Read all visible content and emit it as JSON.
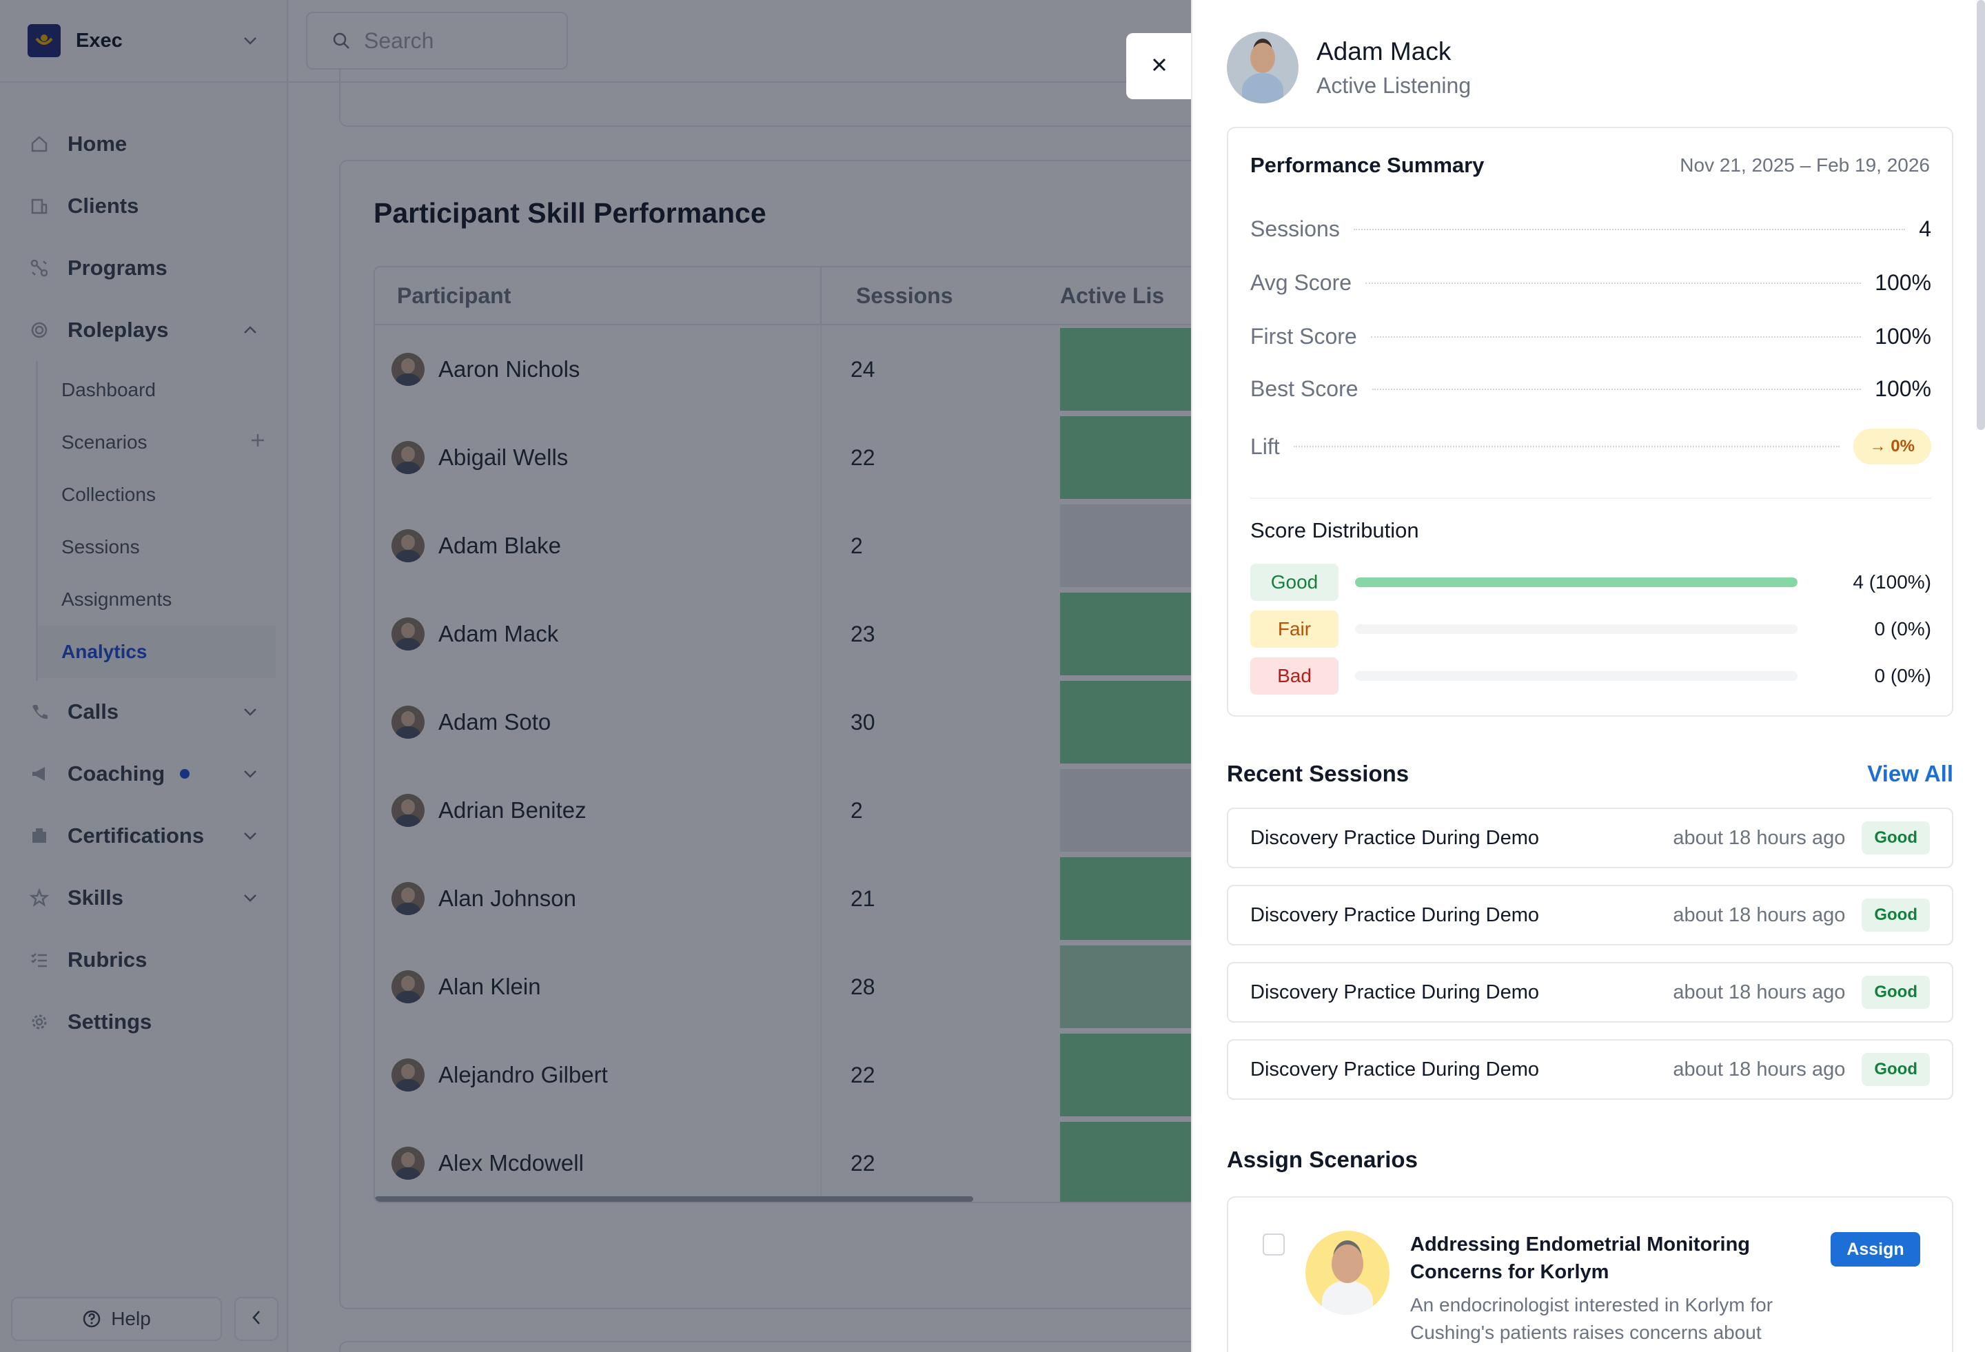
{
  "sidebar": {
    "org_name": "Exec",
    "nav": {
      "home": "Home",
      "clients": "Clients",
      "programs": "Programs",
      "roleplays": "Roleplays",
      "calls": "Calls",
      "coaching": "Coaching",
      "certifications": "Certifications",
      "skills": "Skills",
      "rubrics": "Rubrics",
      "settings": "Settings"
    },
    "roleplays_sub": {
      "dashboard": "Dashboard",
      "scenarios": "Scenarios",
      "collections": "Collections",
      "sessions": "Sessions",
      "assignments": "Assignments",
      "analytics": "Analytics"
    },
    "help_label": "Help"
  },
  "topbar": {
    "search_placeholder": "Search"
  },
  "main": {
    "card_title": "Participant Skill Performance",
    "columns": {
      "participant": "Participant",
      "sessions": "Sessions",
      "active_listening": "Active Lis"
    },
    "rows": [
      {
        "name": "Aaron Nichols",
        "sessions": "24",
        "heat": "#7fd39b"
      },
      {
        "name": "Abigail Wells",
        "sessions": "22",
        "heat": "#7fd39b"
      },
      {
        "name": "Adam Blake",
        "sessions": "2",
        "heat": "#e5e7eb"
      },
      {
        "name": "Adam Mack",
        "sessions": "23",
        "heat": "#7fd39b"
      },
      {
        "name": "Adam Soto",
        "sessions": "30",
        "heat": "#7fd39b"
      },
      {
        "name": "Adrian Benitez",
        "sessions": "2",
        "heat": "#e5e7eb"
      },
      {
        "name": "Alan Johnson",
        "sessions": "21",
        "heat": "#7fd39b"
      },
      {
        "name": "Alan Klein",
        "sessions": "28",
        "heat": "#a8d8b8"
      },
      {
        "name": "Alejandro Gilbert",
        "sessions": "22",
        "heat": "#7fd39b"
      },
      {
        "name": "Alex Mcdowell",
        "sessions": "22",
        "heat": "#7fd39b"
      }
    ]
  },
  "drawer": {
    "name": "Adam Mack",
    "skill": "Active Listening",
    "summary": {
      "title": "Performance Summary",
      "date_range": "Nov 21, 2025 – Feb 19, 2026",
      "sessions_label": "Sessions",
      "sessions_value": "4",
      "avg_label": "Avg Score",
      "avg_value": "100%",
      "first_label": "First Score",
      "first_value": "100%",
      "best_label": "Best Score",
      "best_value": "100%",
      "lift_label": "Lift",
      "lift_value": "→ 0%"
    },
    "distribution": {
      "title": "Score Distribution",
      "good_label": "Good",
      "good_value": "4 (100%)",
      "good_fraction": 1.0,
      "fair_label": "Fair",
      "fair_value": "0 (0%)",
      "fair_fraction": 0,
      "bad_label": "Bad",
      "bad_value": "0 (0%)",
      "bad_fraction": 0
    },
    "recent": {
      "title": "Recent Sessions",
      "view_all": "View All",
      "items": [
        {
          "title": "Discovery Practice During Demo",
          "when": "about 18 hours ago",
          "badge": "Good"
        },
        {
          "title": "Discovery Practice During Demo",
          "when": "about 18 hours ago",
          "badge": "Good"
        },
        {
          "title": "Discovery Practice During Demo",
          "when": "about 18 hours ago",
          "badge": "Good"
        },
        {
          "title": "Discovery Practice During Demo",
          "when": "about 18 hours ago",
          "badge": "Good"
        }
      ]
    },
    "assign": {
      "title": "Assign Scenarios",
      "scenario_title": "Addressing Endometrial Monitoring Concerns for Korlym",
      "scenario_desc": "An endocrinologist interested in Korlym for Cushing's patients raises concerns about",
      "assign_label": "Assign"
    }
  },
  "colors": {
    "accent": "#1d6fd8",
    "good_bg": "#e6f4ec",
    "good_text": "#15803d",
    "fair_bg": "#fef3c7",
    "fair_text": "#b45309",
    "bad_bg": "#fde2e2",
    "bad_text": "#b91c1c",
    "good_bar": "#86d6a6"
  }
}
